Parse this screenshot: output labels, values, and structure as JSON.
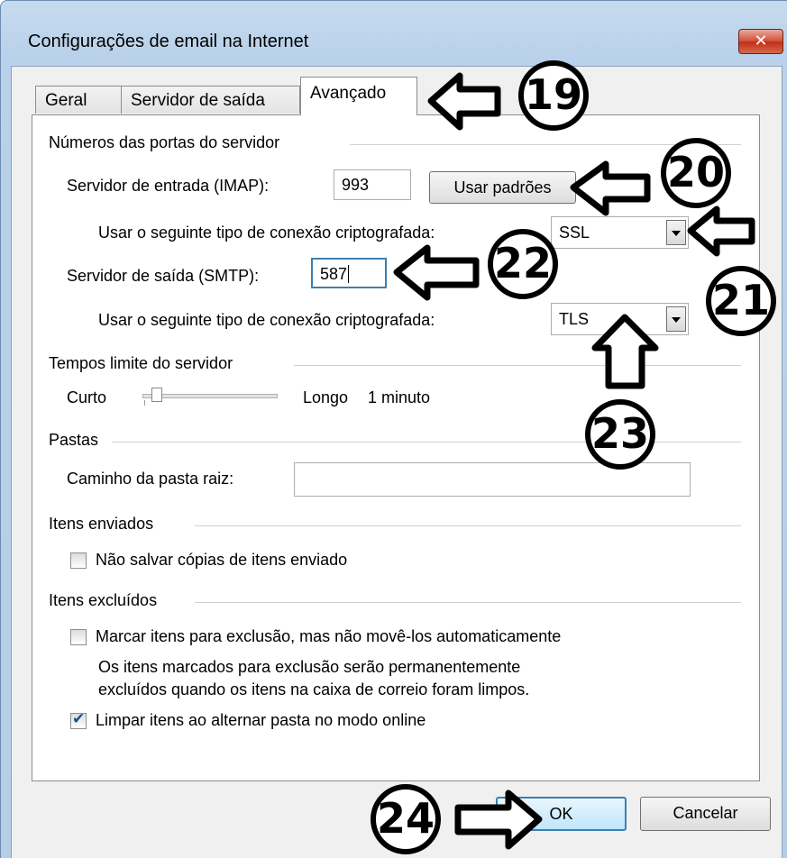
{
  "window": {
    "title": "Configurações de email na Internet",
    "close_glyph": "✕"
  },
  "tabs": [
    {
      "label": "Geral",
      "active": false
    },
    {
      "label": "Servidor de saída",
      "active": false
    },
    {
      "label": "Avançado",
      "active": true
    }
  ],
  "ports": {
    "group_label": "Números das portas do servidor",
    "incoming_label": "Servidor de entrada (IMAP):",
    "incoming_value": "993",
    "defaults_button": "Usar padrões",
    "incoming_enc_label": "Usar o seguinte tipo de conexão criptografada:",
    "incoming_enc_value": "SSL",
    "outgoing_label": "Servidor de saída (SMTP):",
    "outgoing_value": "587",
    "outgoing_enc_label": "Usar o seguinte tipo de conexão criptografada:",
    "outgoing_enc_value": "TLS"
  },
  "timeouts": {
    "group_label": "Tempos limite do servidor",
    "short_label": "Curto",
    "long_label": "Longo",
    "value_label": "1 minuto",
    "slider_level": 0.1
  },
  "folders": {
    "group_label": "Pastas",
    "root_label": "Caminho da pasta raiz:",
    "root_value": ""
  },
  "sent": {
    "group_label": "Itens enviados",
    "dont_save_label": "Não salvar cópias de itens enviado",
    "dont_save_checked": false
  },
  "deleted": {
    "group_label": "Itens excluídos",
    "mark_label": "Marcar itens para exclusão, mas não movê-los automaticamente",
    "mark_checked": false,
    "note_line1": "Os itens marcados para exclusão serão permanentemente",
    "note_line2": "excluídos quando os itens na caixa de correio foram limpos.",
    "purge_label": "Limpar itens ao alternar pasta no modo online",
    "purge_checked": true
  },
  "footer": {
    "ok_label": "OK",
    "cancel_label": "Cancelar"
  },
  "annotations": [
    "19",
    "20",
    "21",
    "22",
    "23",
    "24"
  ]
}
